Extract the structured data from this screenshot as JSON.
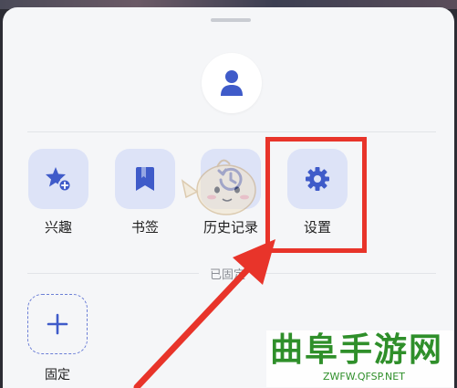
{
  "menu": {
    "tiles": [
      {
        "label": "兴趣",
        "icon": "star-plus-icon"
      },
      {
        "label": "书签",
        "icon": "bookmark-icon"
      },
      {
        "label": "历史记录",
        "icon": "history-icon"
      },
      {
        "label": "设置",
        "icon": "gear-icon"
      }
    ],
    "pinned_section_title": "已固定",
    "add_pinned_label": "固定"
  },
  "watermark": {
    "brand": "曲阜手游网",
    "url": "ZWFW.QFSP.NET"
  },
  "colors": {
    "sheet_bg": "#f5f6f8",
    "tile_bg": "#dde3f7",
    "icon_blue": "#3f5bc9",
    "annotation_red": "#e8342a",
    "watermark_green": "#2f8f2a"
  }
}
